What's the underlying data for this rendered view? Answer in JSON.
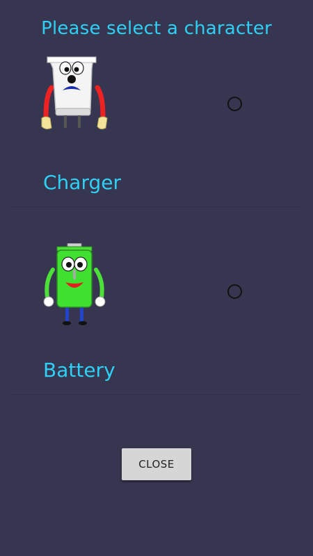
{
  "dialog": {
    "title": "Please select a character",
    "close_label": "CLOSE"
  },
  "options": [
    {
      "label": "Charger",
      "selected": false,
      "icon": "charger-character-icon"
    },
    {
      "label": "Battery",
      "selected": false,
      "icon": "battery-character-icon"
    }
  ],
  "colors": {
    "background": "#373650",
    "accent_text": "#2ed0f5",
    "button_bg": "#d6d6d6"
  }
}
